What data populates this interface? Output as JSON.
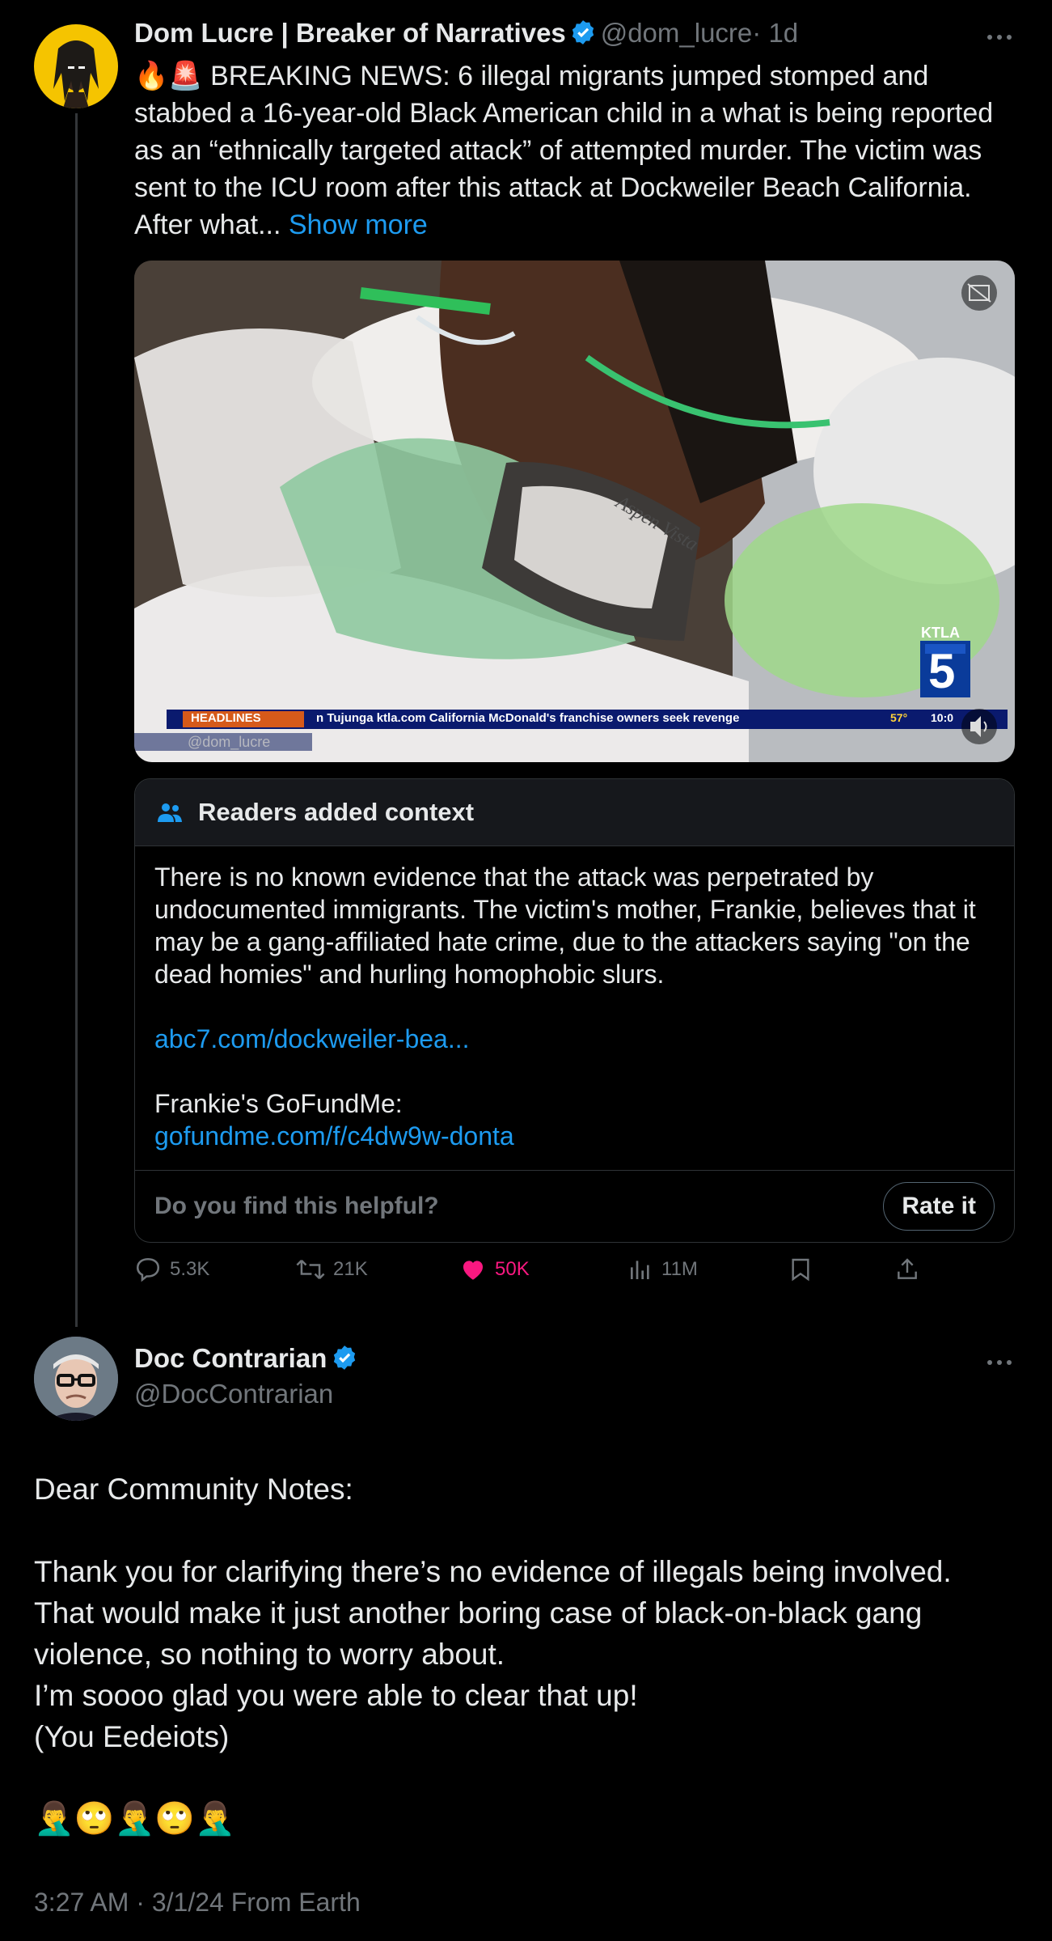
{
  "tweet": {
    "author_name": "Dom Lucre | Breaker of Narratives",
    "author_handle": "@dom_lucre",
    "time_ago": "· 1d",
    "text_emojis": "🔥🚨",
    "text": "BREAKING NEWS: 6 illegal migrants jumped stomped and stabbed a 16-year-old Black American child in a what is being reported as an “ethnically targeted attack” of attempted murder. The victim was sent to the ICU room after this attack at Dockweiler Beach California. After what...",
    "show_more": "Show more",
    "media": {
      "station_logo": "KTLA",
      "channel_number": "5",
      "ticker_label": "HEADLINES",
      "ticker_text": "n Tujunga  ktla.com  California McDonald's franchise owners seek revenge",
      "ticker_temp": "57°",
      "ticker_time": "10:0",
      "watermark": "@dom_lucre",
      "brace_brand": "Aspen Vista"
    },
    "note": {
      "title": "Readers added context",
      "body": "There is no known evidence that the attack was perpetrated by undocumented immigrants. The victim's mother, Frankie, believes that it may be a gang-affiliated hate crime, due to the attackers saying \"on the dead homies\" and hurling homophobic slurs.",
      "link1": "abc7.com/dockweiler-bea...",
      "gofundme_label": "Frankie's GoFundMe:",
      "link2": "gofundme.com/f/c4dw9w-donta",
      "question": "Do you find this helpful?",
      "rate_label": "Rate it"
    },
    "stats": {
      "replies": "5.3K",
      "retweets": "21K",
      "likes": "50K",
      "views": "11M"
    }
  },
  "reply": {
    "author_name": "Doc Contrarian",
    "author_handle": "@DocContrarian",
    "lines": [
      "Dear Community Notes:",
      "",
      "Thank you for clarifying there’s no evidence of illegals being involved.",
      "That would make it just another boring case of black-on-black gang",
      "violence, so nothing to worry about.",
      "I’m soooo glad you were able to clear that up!",
      "(You Eedeiots)",
      "",
      "🤦‍♂️🙄🤦‍♂️🙄🤦‍♂️"
    ],
    "timestamp": "3:27 AM · 3/1/24 From Earth"
  },
  "colors": {
    "background": "#000000",
    "text": "#e7e9ea",
    "secondary": "#71767b",
    "link": "#1d9bf0",
    "like": "#f91880",
    "verified": "#1d9bf0"
  }
}
